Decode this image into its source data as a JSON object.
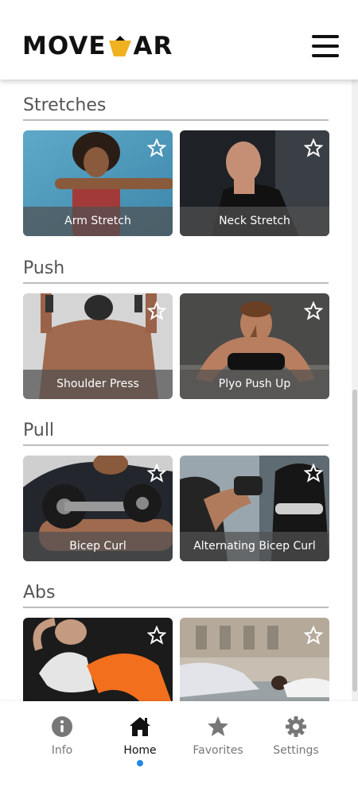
{
  "header": {
    "logo_left": "MOVE",
    "logo_right": "AR",
    "brand_color": "#f0b120",
    "menu_icon": "hamburger-menu-icon"
  },
  "sections": [
    {
      "title": "Stretches",
      "cards": [
        {
          "label": "Arm Stretch"
        },
        {
          "label": "Neck Stretch"
        }
      ]
    },
    {
      "title": "Push",
      "cards": [
        {
          "label": "Shoulder Press"
        },
        {
          "label": "Plyo Push Up"
        }
      ]
    },
    {
      "title": "Pull",
      "cards": [
        {
          "label": "Bicep Curl"
        },
        {
          "label": "Alternating Bicep Curl"
        }
      ]
    },
    {
      "title": "Abs",
      "cards": [
        {
          "label": ""
        },
        {
          "label": ""
        }
      ]
    }
  ],
  "nav": {
    "items": [
      {
        "label": "Info",
        "icon": "info-icon"
      },
      {
        "label": "Home",
        "icon": "home-icon"
      },
      {
        "label": "Favorites",
        "icon": "star-icon"
      },
      {
        "label": "Settings",
        "icon": "gear-icon"
      }
    ],
    "active_color": "#1e88e5"
  }
}
